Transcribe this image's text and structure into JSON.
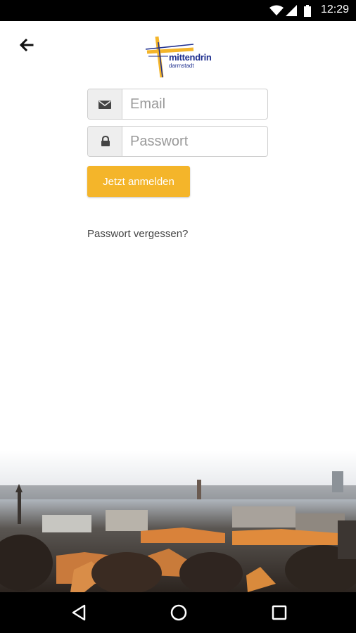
{
  "status_bar": {
    "time": "12:29",
    "icons": [
      "wifi-icon",
      "signal-icon",
      "battery-icon"
    ]
  },
  "header": {
    "back_icon": "arrow-left-icon",
    "logo": {
      "title": "mittendrin",
      "subtitle": "darmstadt",
      "colors": {
        "cross": "#f4b52a",
        "text": "#1e2f8f"
      }
    }
  },
  "login_form": {
    "email": {
      "placeholder": "Email",
      "value": "",
      "icon": "envelope-icon"
    },
    "password": {
      "placeholder": "Passwort",
      "value": "",
      "icon": "lock-icon"
    },
    "submit_label": "Jetzt anmelden",
    "forgot_label": "Passwort vergessen?"
  },
  "background_image": "city-skyline-photo",
  "nav_bar": {
    "icons": [
      "back-triangle-icon",
      "home-circle-icon",
      "recents-square-icon"
    ]
  },
  "colors": {
    "accent": "#f4b52a",
    "brand": "#1e2f8f"
  }
}
